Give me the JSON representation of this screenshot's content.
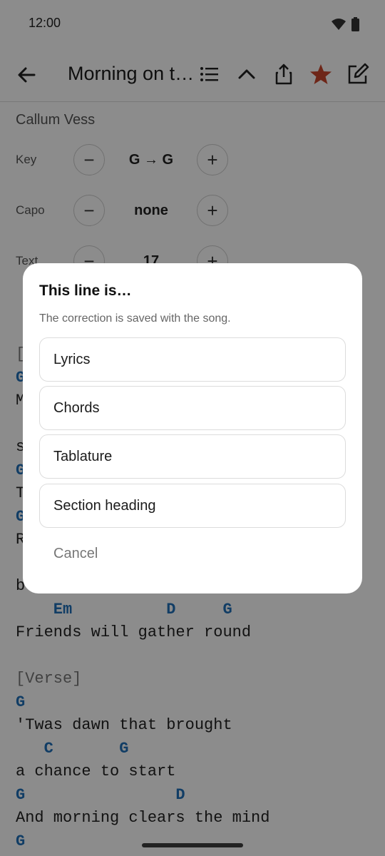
{
  "status": {
    "time": "12:00"
  },
  "appbar": {
    "title": "Morning on t…"
  },
  "song": {
    "artist": "Callum Vess",
    "controls": [
      {
        "label": "Key",
        "value": "G → G"
      },
      {
        "label": "Capo",
        "value": "none"
      },
      {
        "label": "Text",
        "value": "17"
      }
    ],
    "left_fragments": [
      "[",
      "G",
      "M",
      "s",
      "G",
      "T",
      "G",
      "R",
      "b"
    ],
    "lines": [
      {
        "kind": "chords",
        "text": "    Em          D     G"
      },
      {
        "kind": "lyrics",
        "text": "Friends will gather round"
      },
      {
        "kind": "section",
        "text": "[Verse]"
      },
      {
        "kind": "chords",
        "text": "G"
      },
      {
        "kind": "lyrics",
        "text": "'Twas dawn that brought"
      },
      {
        "kind": "chords",
        "text": "   C       G"
      },
      {
        "kind": "lyrics",
        "text": "a chance to start"
      },
      {
        "kind": "chords",
        "text": "G                D"
      },
      {
        "kind": "lyrics",
        "text": "And morning clears the mind"
      },
      {
        "kind": "chords",
        "text": "G"
      }
    ]
  },
  "dialog": {
    "title": "This line is…",
    "subtitle": "The correction is saved with the song.",
    "options": [
      "Lyrics",
      "Chords",
      "Tablature",
      "Section heading"
    ],
    "cancel": "Cancel"
  },
  "colors": {
    "favorite": "#c8452c",
    "chord": "#1f6fb8"
  },
  "icons": [
    "wifi-icon",
    "battery-icon",
    "back-arrow-icon",
    "list-icon",
    "chevron-up-icon",
    "share-icon",
    "star-icon",
    "edit-icon"
  ]
}
